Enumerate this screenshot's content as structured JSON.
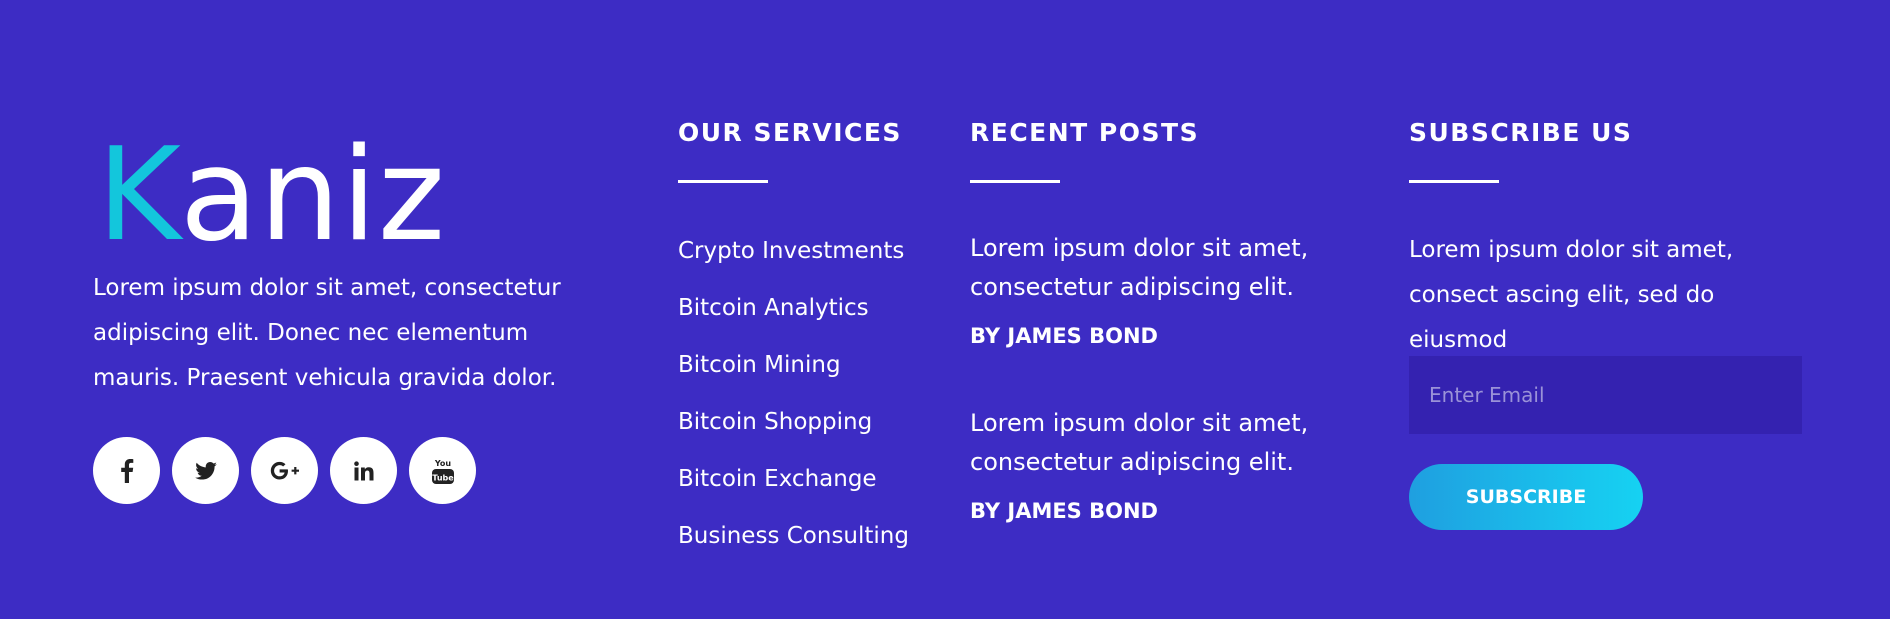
{
  "brand": {
    "logo_first": "K",
    "logo_rest": "aniz",
    "description": "Lorem ipsum dolor sit amet, consectetur adipiscing elit. Donec nec elementum mauris. Praesent vehicula gravida dolor.",
    "accent_color": "#13c6dc",
    "socials": [
      {
        "name": "facebook-icon"
      },
      {
        "name": "twitter-icon"
      },
      {
        "name": "google-plus-icon"
      },
      {
        "name": "linkedin-icon"
      },
      {
        "name": "youtube-icon"
      }
    ]
  },
  "services": {
    "title": "OUR SERVICES",
    "items": [
      "Crypto Investments",
      "Bitcoin Analytics",
      "Bitcoin Mining",
      "Bitcoin Shopping",
      "Bitcoin Exchange",
      "Business Consulting"
    ]
  },
  "posts": {
    "title": "RECENT POSTS",
    "items": [
      {
        "title": "Lorem ipsum dolor sit amet, consectetur adipiscing elit.",
        "author": "BY JAMES BOND"
      },
      {
        "title": "Lorem ipsum dolor sit amet, consectetur adipiscing elit.",
        "author": "BY JAMES BOND"
      }
    ]
  },
  "subscribe": {
    "title": "SUBSCRIBE US",
    "text": "Lorem ipsum dolor sit amet, consect ascing elit, sed do eiusmod",
    "placeholder": "Enter Email",
    "button_label": "SUBSCRIBE"
  },
  "colors": {
    "background": "#3d2cc4",
    "input_background": "#3422b0",
    "button_gradient_start": "#1f9fe0",
    "button_gradient_end": "#16d2f2"
  }
}
